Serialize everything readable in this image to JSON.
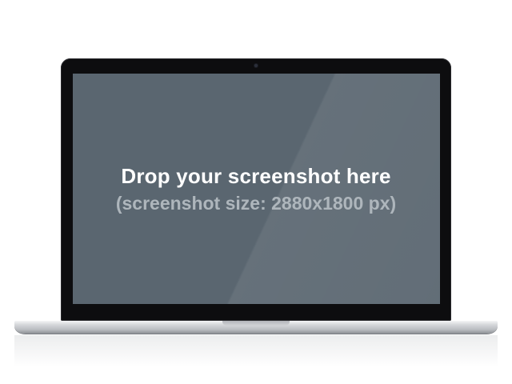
{
  "placeholder": {
    "headline": "Drop your screenshot here",
    "subline": "(screenshot size: 2880x1800 px)"
  },
  "colors": {
    "screen": "#5a6670",
    "bezel": "#0d0d0f",
    "headline_text": "#ffffff",
    "subline_text": "#aeb6bc"
  }
}
